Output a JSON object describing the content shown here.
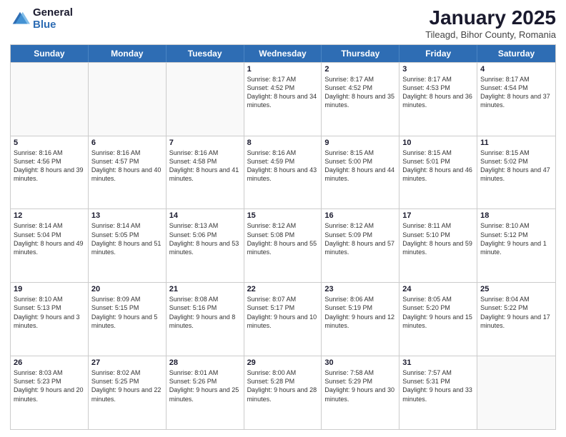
{
  "logo": {
    "general": "General",
    "blue": "Blue"
  },
  "header": {
    "month": "January 2025",
    "location": "Tileagd, Bihor County, Romania"
  },
  "weekdays": [
    "Sunday",
    "Monday",
    "Tuesday",
    "Wednesday",
    "Thursday",
    "Friday",
    "Saturday"
  ],
  "weeks": [
    [
      {
        "day": "",
        "sunrise": "",
        "sunset": "",
        "daylight": ""
      },
      {
        "day": "",
        "sunrise": "",
        "sunset": "",
        "daylight": ""
      },
      {
        "day": "",
        "sunrise": "",
        "sunset": "",
        "daylight": ""
      },
      {
        "day": "1",
        "sunrise": "Sunrise: 8:17 AM",
        "sunset": "Sunset: 4:52 PM",
        "daylight": "Daylight: 8 hours and 34 minutes."
      },
      {
        "day": "2",
        "sunrise": "Sunrise: 8:17 AM",
        "sunset": "Sunset: 4:52 PM",
        "daylight": "Daylight: 8 hours and 35 minutes."
      },
      {
        "day": "3",
        "sunrise": "Sunrise: 8:17 AM",
        "sunset": "Sunset: 4:53 PM",
        "daylight": "Daylight: 8 hours and 36 minutes."
      },
      {
        "day": "4",
        "sunrise": "Sunrise: 8:17 AM",
        "sunset": "Sunset: 4:54 PM",
        "daylight": "Daylight: 8 hours and 37 minutes."
      }
    ],
    [
      {
        "day": "5",
        "sunrise": "Sunrise: 8:16 AM",
        "sunset": "Sunset: 4:56 PM",
        "daylight": "Daylight: 8 hours and 39 minutes."
      },
      {
        "day": "6",
        "sunrise": "Sunrise: 8:16 AM",
        "sunset": "Sunset: 4:57 PM",
        "daylight": "Daylight: 8 hours and 40 minutes."
      },
      {
        "day": "7",
        "sunrise": "Sunrise: 8:16 AM",
        "sunset": "Sunset: 4:58 PM",
        "daylight": "Daylight: 8 hours and 41 minutes."
      },
      {
        "day": "8",
        "sunrise": "Sunrise: 8:16 AM",
        "sunset": "Sunset: 4:59 PM",
        "daylight": "Daylight: 8 hours and 43 minutes."
      },
      {
        "day": "9",
        "sunrise": "Sunrise: 8:15 AM",
        "sunset": "Sunset: 5:00 PM",
        "daylight": "Daylight: 8 hours and 44 minutes."
      },
      {
        "day": "10",
        "sunrise": "Sunrise: 8:15 AM",
        "sunset": "Sunset: 5:01 PM",
        "daylight": "Daylight: 8 hours and 46 minutes."
      },
      {
        "day": "11",
        "sunrise": "Sunrise: 8:15 AM",
        "sunset": "Sunset: 5:02 PM",
        "daylight": "Daylight: 8 hours and 47 minutes."
      }
    ],
    [
      {
        "day": "12",
        "sunrise": "Sunrise: 8:14 AM",
        "sunset": "Sunset: 5:04 PM",
        "daylight": "Daylight: 8 hours and 49 minutes."
      },
      {
        "day": "13",
        "sunrise": "Sunrise: 8:14 AM",
        "sunset": "Sunset: 5:05 PM",
        "daylight": "Daylight: 8 hours and 51 minutes."
      },
      {
        "day": "14",
        "sunrise": "Sunrise: 8:13 AM",
        "sunset": "Sunset: 5:06 PM",
        "daylight": "Daylight: 8 hours and 53 minutes."
      },
      {
        "day": "15",
        "sunrise": "Sunrise: 8:12 AM",
        "sunset": "Sunset: 5:08 PM",
        "daylight": "Daylight: 8 hours and 55 minutes."
      },
      {
        "day": "16",
        "sunrise": "Sunrise: 8:12 AM",
        "sunset": "Sunset: 5:09 PM",
        "daylight": "Daylight: 8 hours and 57 minutes."
      },
      {
        "day": "17",
        "sunrise": "Sunrise: 8:11 AM",
        "sunset": "Sunset: 5:10 PM",
        "daylight": "Daylight: 8 hours and 59 minutes."
      },
      {
        "day": "18",
        "sunrise": "Sunrise: 8:10 AM",
        "sunset": "Sunset: 5:12 PM",
        "daylight": "Daylight: 9 hours and 1 minute."
      }
    ],
    [
      {
        "day": "19",
        "sunrise": "Sunrise: 8:10 AM",
        "sunset": "Sunset: 5:13 PM",
        "daylight": "Daylight: 9 hours and 3 minutes."
      },
      {
        "day": "20",
        "sunrise": "Sunrise: 8:09 AM",
        "sunset": "Sunset: 5:15 PM",
        "daylight": "Daylight: 9 hours and 5 minutes."
      },
      {
        "day": "21",
        "sunrise": "Sunrise: 8:08 AM",
        "sunset": "Sunset: 5:16 PM",
        "daylight": "Daylight: 9 hours and 8 minutes."
      },
      {
        "day": "22",
        "sunrise": "Sunrise: 8:07 AM",
        "sunset": "Sunset: 5:17 PM",
        "daylight": "Daylight: 9 hours and 10 minutes."
      },
      {
        "day": "23",
        "sunrise": "Sunrise: 8:06 AM",
        "sunset": "Sunset: 5:19 PM",
        "daylight": "Daylight: 9 hours and 12 minutes."
      },
      {
        "day": "24",
        "sunrise": "Sunrise: 8:05 AM",
        "sunset": "Sunset: 5:20 PM",
        "daylight": "Daylight: 9 hours and 15 minutes."
      },
      {
        "day": "25",
        "sunrise": "Sunrise: 8:04 AM",
        "sunset": "Sunset: 5:22 PM",
        "daylight": "Daylight: 9 hours and 17 minutes."
      }
    ],
    [
      {
        "day": "26",
        "sunrise": "Sunrise: 8:03 AM",
        "sunset": "Sunset: 5:23 PM",
        "daylight": "Daylight: 9 hours and 20 minutes."
      },
      {
        "day": "27",
        "sunrise": "Sunrise: 8:02 AM",
        "sunset": "Sunset: 5:25 PM",
        "daylight": "Daylight: 9 hours and 22 minutes."
      },
      {
        "day": "28",
        "sunrise": "Sunrise: 8:01 AM",
        "sunset": "Sunset: 5:26 PM",
        "daylight": "Daylight: 9 hours and 25 minutes."
      },
      {
        "day": "29",
        "sunrise": "Sunrise: 8:00 AM",
        "sunset": "Sunset: 5:28 PM",
        "daylight": "Daylight: 9 hours and 28 minutes."
      },
      {
        "day": "30",
        "sunrise": "Sunrise: 7:58 AM",
        "sunset": "Sunset: 5:29 PM",
        "daylight": "Daylight: 9 hours and 30 minutes."
      },
      {
        "day": "31",
        "sunrise": "Sunrise: 7:57 AM",
        "sunset": "Sunset: 5:31 PM",
        "daylight": "Daylight: 9 hours and 33 minutes."
      },
      {
        "day": "",
        "sunrise": "",
        "sunset": "",
        "daylight": ""
      }
    ]
  ]
}
